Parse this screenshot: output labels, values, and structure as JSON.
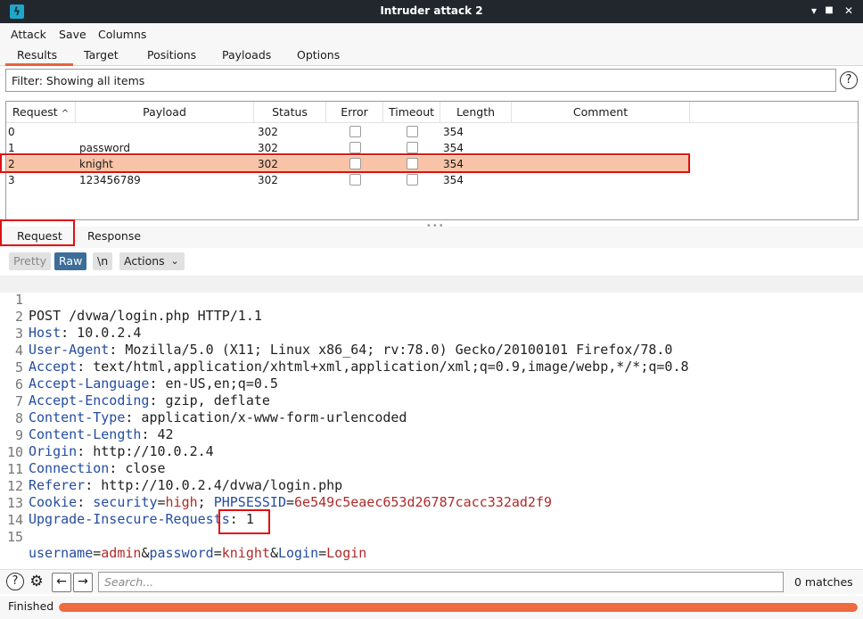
{
  "window": {
    "title": "Intruder attack 2",
    "minimize": "▾",
    "maximize": "■",
    "close": "✕"
  },
  "menu": [
    "Attack",
    "Save",
    "Columns"
  ],
  "main_tabs": [
    "Results",
    "Target",
    "Positions",
    "Payloads",
    "Options"
  ],
  "filter": {
    "text": "Filter: Showing all items",
    "help": "?"
  },
  "table": {
    "columns": [
      "Request",
      "Payload",
      "Status",
      "Error",
      "Timeout",
      "Length",
      "Comment"
    ],
    "sort_indicator": "^",
    "rows": [
      {
        "request": "0",
        "payload": "",
        "status": "302",
        "length": "354"
      },
      {
        "request": "1",
        "payload": "password",
        "status": "302",
        "length": "354"
      },
      {
        "request": "2",
        "payload": "knight",
        "status": "302",
        "length": "354"
      },
      {
        "request": "3",
        "payload": "123456789",
        "status": "302",
        "length": "354"
      }
    ],
    "selected_row": 2
  },
  "splitter": "•••",
  "detail_tabs": [
    "Request",
    "Response"
  ],
  "toolbar": {
    "pretty": "Pretty",
    "raw": "Raw",
    "newline": "\\n",
    "actions": "Actions",
    "actions_chevron": "⌄"
  },
  "editor": {
    "line_numbers": [
      "1",
      "2",
      "3",
      "4",
      "5",
      "6",
      "7",
      "8",
      "9",
      "10",
      "11",
      "12",
      "13",
      "14",
      "15"
    ],
    "line1": "POST /dvwa/login.php HTTP/1.1",
    "headers": [
      {
        "k": "Host",
        "v": " 10.0.2.4"
      },
      {
        "k": "User-Agent",
        "v": " Mozilla/5.0 (X11; Linux x86_64; rv:78.0) Gecko/20100101 Firefox/78.0"
      },
      {
        "k": "Accept",
        "v": " text/html,application/xhtml+xml,application/xml;q=0.9,image/webp,*/*;q=0.8"
      },
      {
        "k": "Accept-Language",
        "v": " en-US,en;q=0.5"
      },
      {
        "k": "Accept-Encoding",
        "v": " gzip, deflate"
      },
      {
        "k": "Content-Type",
        "v": " application/x-www-form-urlencoded"
      },
      {
        "k": "Content-Length",
        "v": " 42"
      },
      {
        "k": "Origin",
        "v": " http://10.0.2.4"
      },
      {
        "k": "Connection",
        "v": " close"
      },
      {
        "k": "Referer",
        "v": " http://10.0.2.4/dvwa/login.php"
      }
    ],
    "cookie": {
      "k": "Cookie",
      "n1": "security",
      "v1": "high",
      "n2": "PHPSESSID",
      "v2": "6e549c5eaec653d26787cacc332ad2f9"
    },
    "upgrade": {
      "k": "Upgrade-Insecure-Requests",
      "v": " 1"
    },
    "body": {
      "n1": "username",
      "v1": "admin",
      "n2": "password",
      "v2": "knight",
      "n3": "Login",
      "v3": "Login"
    }
  },
  "search": {
    "placeholder": "Search...",
    "matches": "0 matches",
    "help": "?",
    "gear": "⚙",
    "prev": "←",
    "next": "→"
  },
  "status": {
    "text": "Finished",
    "progress": 1.0
  },
  "colors": {
    "accent": "#ee6a3f",
    "highlight_outline": "#e01010",
    "selected_row": "#f8c3a6"
  }
}
